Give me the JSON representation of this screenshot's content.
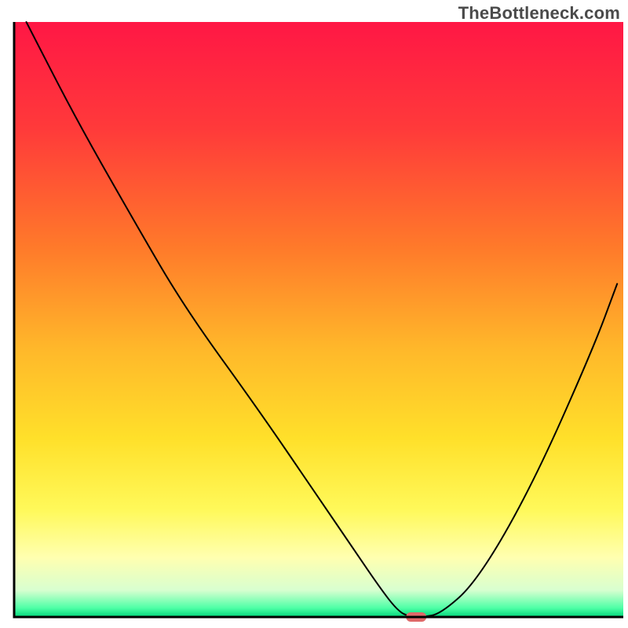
{
  "watermark": "TheBottleneck.com",
  "chart_data": {
    "type": "line",
    "title": "",
    "xlabel": "",
    "ylabel": "",
    "xlim": [
      0,
      100
    ],
    "ylim": [
      0,
      100
    ],
    "x": [
      2,
      10,
      20,
      28,
      40,
      50,
      56,
      60,
      63,
      65,
      67,
      70,
      76,
      85,
      95,
      99
    ],
    "values": [
      100,
      84,
      66,
      52,
      35,
      20,
      11,
      5,
      1,
      0,
      0,
      0.5,
      6,
      22,
      45,
      56
    ],
    "marker": {
      "x": 66,
      "y": 0
    },
    "gradient_stops": [
      {
        "pos": 0.0,
        "color": "#ff1745"
      },
      {
        "pos": 0.18,
        "color": "#ff3a3a"
      },
      {
        "pos": 0.38,
        "color": "#ff7a2a"
      },
      {
        "pos": 0.55,
        "color": "#ffb82a"
      },
      {
        "pos": 0.7,
        "color": "#ffe02a"
      },
      {
        "pos": 0.82,
        "color": "#fff95a"
      },
      {
        "pos": 0.9,
        "color": "#ffffb0"
      },
      {
        "pos": 0.955,
        "color": "#d8ffd0"
      },
      {
        "pos": 0.985,
        "color": "#4dffa6"
      },
      {
        "pos": 1.0,
        "color": "#00d67a"
      }
    ],
    "curve_color": "#000000",
    "border_color": "#000000",
    "marker_color": "#e06a6a"
  }
}
